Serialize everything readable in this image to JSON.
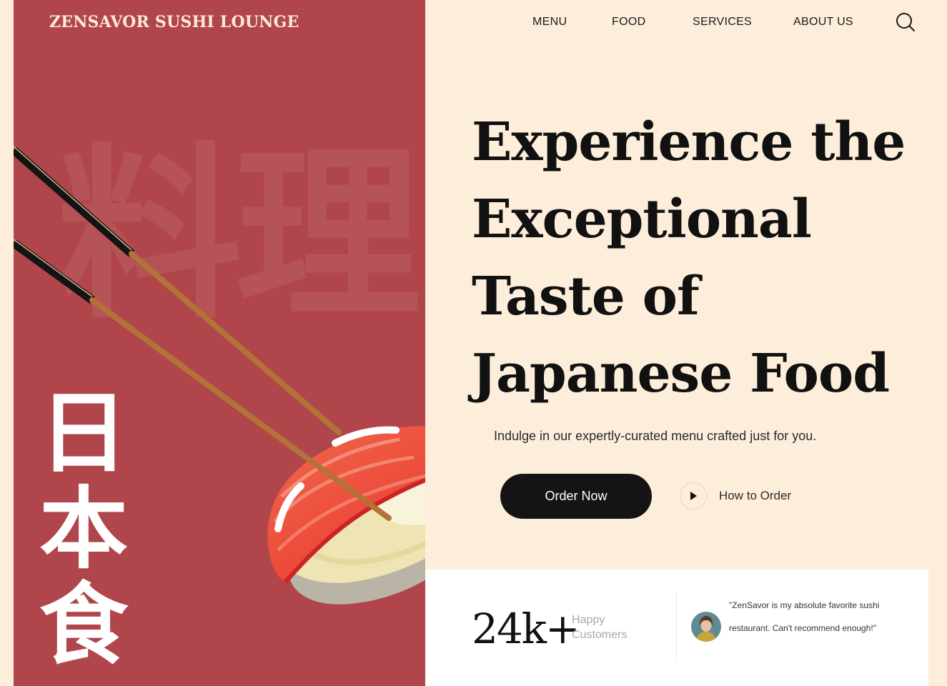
{
  "brand": {
    "name": "ZENSAVOR SUSHI LOUNGE"
  },
  "nav": {
    "items": [
      "MENU",
      "FOOD",
      "SERVICES",
      "ABOUT US"
    ],
    "search_icon": "search-icon"
  },
  "art": {
    "watermark": "料理",
    "vertical_text": "日本食"
  },
  "hero": {
    "title": "Experience the Exceptional Taste of Japanese Food",
    "subtitle": "Indulge in our expertly-curated menu crafted just for you.",
    "cta_primary": "Order Now",
    "cta_secondary": "How to Order"
  },
  "stats": {
    "count": "24k+",
    "label": "Happy Customers",
    "testimonial": "\"ZenSavor is my absolute favorite sushi restaurant. Can't recommend enough!\""
  },
  "colors": {
    "panel": "#b0464b",
    "background": "#fdeedb",
    "button": "#141414"
  }
}
